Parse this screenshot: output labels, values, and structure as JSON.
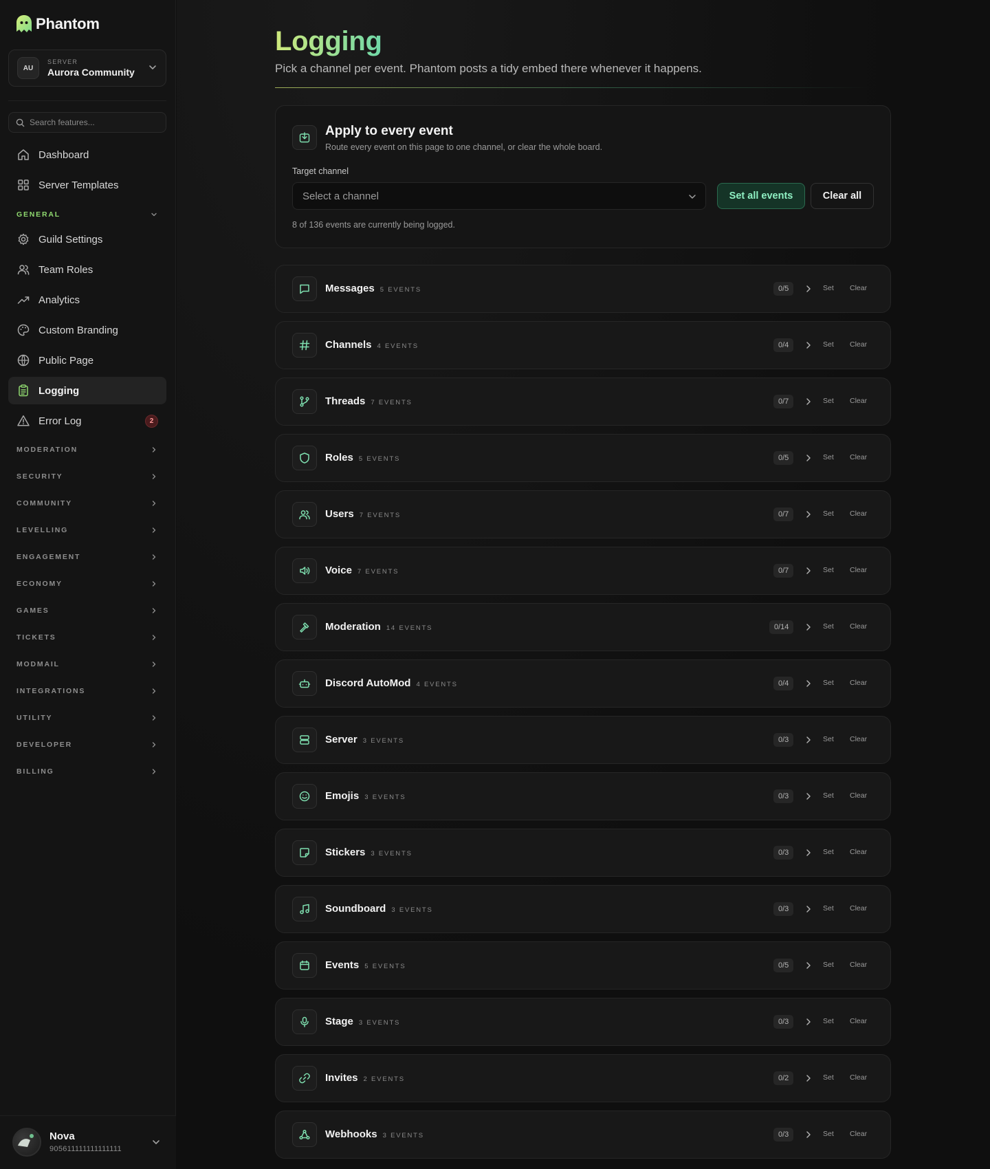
{
  "brand": {
    "name": "Phantom"
  },
  "server": {
    "avatar": "AU",
    "kicker": "SERVER",
    "name": "Aurora Community"
  },
  "search": {
    "placeholder": "Search features..."
  },
  "nav": {
    "top": [
      {
        "label": "Dashboard",
        "icon": "home-icon"
      },
      {
        "label": "Server Templates",
        "icon": "grid-icon"
      }
    ],
    "general_label": "GENERAL",
    "general": [
      {
        "label": "Guild Settings",
        "icon": "gear-icon"
      },
      {
        "label": "Team Roles",
        "icon": "users-icon"
      },
      {
        "label": "Analytics",
        "icon": "trend-icon"
      },
      {
        "label": "Custom Branding",
        "icon": "palette-icon"
      },
      {
        "label": "Public Page",
        "icon": "globe-icon"
      },
      {
        "label": "Logging",
        "icon": "clipboard-icon",
        "active": true
      },
      {
        "label": "Error Log",
        "icon": "warning-icon",
        "badge": "2"
      }
    ],
    "sections": [
      "MODERATION",
      "SECURITY",
      "COMMUNITY",
      "LEVELLING",
      "ENGAGEMENT",
      "ECONOMY",
      "GAMES",
      "TICKETS",
      "MODMAIL",
      "INTEGRATIONS",
      "UTILITY",
      "DEVELOPER",
      "BILLING"
    ]
  },
  "user": {
    "name": "Nova",
    "id": "905611111111111111"
  },
  "page": {
    "title": "Logging",
    "subtitle": "Pick a channel per event. Phantom posts a tidy embed there whenever it happens."
  },
  "apply": {
    "title": "Apply to every event",
    "description": "Route every event on this page to one channel, or clear the whole board.",
    "target_label": "Target channel",
    "select_placeholder": "Select a channel",
    "set_all_label": "Set all events",
    "clear_all_label": "Clear all",
    "status": "8 of 136 events are currently being logged."
  },
  "categories": [
    {
      "name": "Messages",
      "count": "5 EVENTS",
      "progress": "0/5",
      "icon": "message-icon"
    },
    {
      "name": "Channels",
      "count": "4 EVENTS",
      "progress": "0/4",
      "icon": "hash-icon"
    },
    {
      "name": "Threads",
      "count": "7 EVENTS",
      "progress": "0/7",
      "icon": "branch-icon"
    },
    {
      "name": "Roles",
      "count": "5 EVENTS",
      "progress": "0/5",
      "icon": "shield-icon"
    },
    {
      "name": "Users",
      "count": "7 EVENTS",
      "progress": "0/7",
      "icon": "users-icon"
    },
    {
      "name": "Voice",
      "count": "7 EVENTS",
      "progress": "0/7",
      "icon": "speaker-icon"
    },
    {
      "name": "Moderation",
      "count": "14 EVENTS",
      "progress": "0/14",
      "icon": "hammer-icon"
    },
    {
      "name": "Discord AutoMod",
      "count": "4 EVENTS",
      "progress": "0/4",
      "icon": "bot-icon"
    },
    {
      "name": "Server",
      "count": "3 EVENTS",
      "progress": "0/3",
      "icon": "server-icon"
    },
    {
      "name": "Emojis",
      "count": "3 EVENTS",
      "progress": "0/3",
      "icon": "smile-icon"
    },
    {
      "name": "Stickers",
      "count": "3 EVENTS",
      "progress": "0/3",
      "icon": "sticker-icon"
    },
    {
      "name": "Soundboard",
      "count": "3 EVENTS",
      "progress": "0/3",
      "icon": "music-icon"
    },
    {
      "name": "Events",
      "count": "5 EVENTS",
      "progress": "0/5",
      "icon": "calendar-icon"
    },
    {
      "name": "Stage",
      "count": "3 EVENTS",
      "progress": "0/3",
      "icon": "mic-icon"
    },
    {
      "name": "Invites",
      "count": "2 EVENTS",
      "progress": "0/2",
      "icon": "link-icon"
    },
    {
      "name": "Webhooks",
      "count": "3 EVENTS",
      "progress": "0/3",
      "icon": "webhook-icon"
    }
  ],
  "row_actions": {
    "set": "Set",
    "clear": "Clear"
  },
  "colors": {
    "accent": "#8ff0c3",
    "brand": "#b9e86a",
    "badge": "#ff9a9a"
  }
}
